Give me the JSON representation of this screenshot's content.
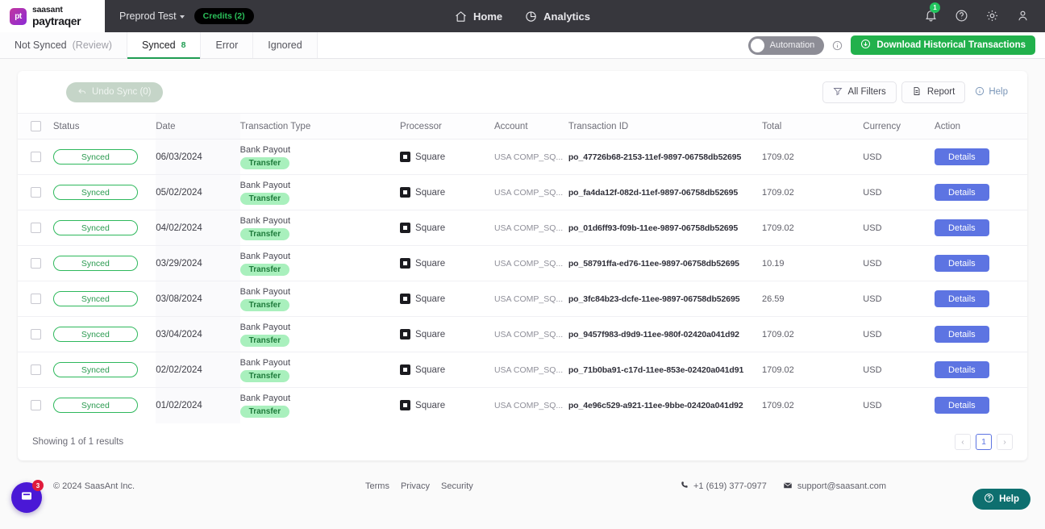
{
  "topbar": {
    "brand": {
      "mark": "pt",
      "line1": "saasant",
      "line2": "paytraqer"
    },
    "environment": "Preprod Test",
    "credits": "Credits (2)",
    "nav": [
      {
        "label": "Home",
        "icon": "home-icon"
      },
      {
        "label": "Analytics",
        "icon": "pie-chart-icon"
      }
    ],
    "notifications_count": "1",
    "icons": [
      "bell-icon",
      "help-circle-icon",
      "gear-icon",
      "user-icon"
    ]
  },
  "tabs": [
    {
      "label": "Not Synced",
      "sublabel": "(Review)",
      "count": "",
      "active": false
    },
    {
      "label": "Synced",
      "sublabel": "",
      "count": "8",
      "active": true
    },
    {
      "label": "Error",
      "sublabel": "",
      "count": "",
      "active": false
    },
    {
      "label": "Ignored",
      "sublabel": "",
      "count": "",
      "active": false
    }
  ],
  "toolbar": {
    "automation_label": "Automation",
    "download_label": "Download Historical Transactions",
    "undo_label": "Undo Sync (0)",
    "all_filters_label": "All Filters",
    "report_label": "Report",
    "help_label": "Help"
  },
  "table": {
    "columns": [
      "Status",
      "Date",
      "Transaction Type",
      "Processor",
      "Account",
      "Transaction ID",
      "Total",
      "Currency",
      "Action"
    ],
    "rows": [
      {
        "status": "Synced",
        "date": "06/03/2024",
        "type": "Bank Payout",
        "tag": "Transfer",
        "processor": "Square",
        "account": "USA COMP_SQ...",
        "txid": "po_47726b68-2153-11ef-9897-06758db52695",
        "total": "1709.02",
        "currency": "USD",
        "action": "Details"
      },
      {
        "status": "Synced",
        "date": "05/02/2024",
        "type": "Bank Payout",
        "tag": "Transfer",
        "processor": "Square",
        "account": "USA COMP_SQ...",
        "txid": "po_fa4da12f-082d-11ef-9897-06758db52695",
        "total": "1709.02",
        "currency": "USD",
        "action": "Details"
      },
      {
        "status": "Synced",
        "date": "04/02/2024",
        "type": "Bank Payout",
        "tag": "Transfer",
        "processor": "Square",
        "account": "USA COMP_SQ...",
        "txid": "po_01d6ff93-f09b-11ee-9897-06758db52695",
        "total": "1709.02",
        "currency": "USD",
        "action": "Details"
      },
      {
        "status": "Synced",
        "date": "03/29/2024",
        "type": "Bank Payout",
        "tag": "Transfer",
        "processor": "Square",
        "account": "USA COMP_SQ...",
        "txid": "po_58791ffa-ed76-11ee-9897-06758db52695",
        "total": "10.19",
        "currency": "USD",
        "action": "Details"
      },
      {
        "status": "Synced",
        "date": "03/08/2024",
        "type": "Bank Payout",
        "tag": "Transfer",
        "processor": "Square",
        "account": "USA COMP_SQ...",
        "txid": "po_3fc84b23-dcfe-11ee-9897-06758db52695",
        "total": "26.59",
        "currency": "USD",
        "action": "Details"
      },
      {
        "status": "Synced",
        "date": "03/04/2024",
        "type": "Bank Payout",
        "tag": "Transfer",
        "processor": "Square",
        "account": "USA COMP_SQ...",
        "txid": "po_9457f983-d9d9-11ee-980f-02420a041d92",
        "total": "1709.02",
        "currency": "USD",
        "action": "Details"
      },
      {
        "status": "Synced",
        "date": "02/02/2024",
        "type": "Bank Payout",
        "tag": "Transfer",
        "processor": "Square",
        "account": "USA COMP_SQ...",
        "txid": "po_71b0ba91-c17d-11ee-853e-02420a041d91",
        "total": "1709.02",
        "currency": "USD",
        "action": "Details"
      },
      {
        "status": "Synced",
        "date": "01/02/2024",
        "type": "Bank Payout",
        "tag": "Transfer",
        "processor": "Square",
        "account": "USA COMP_SQ...",
        "txid": "po_4e96c529-a921-11ee-9bbe-02420a041d92",
        "total": "1709.02",
        "currency": "USD",
        "action": "Details"
      }
    ]
  },
  "card_footer": {
    "showing": "Showing 1 of 1 results",
    "prev": "‹",
    "page": "1",
    "next": "›"
  },
  "page_footer": {
    "copyright": "© 2024 SaasAnt Inc.",
    "legal": [
      "Terms",
      "Privacy",
      "Security"
    ],
    "phone": "+1 (619) 377-0977",
    "email": "support@saasant.com",
    "help_fab": "Help",
    "chat_badge": "3"
  },
  "colors": {
    "accent_green": "#22b14c",
    "details_blue": "#5d74e2",
    "topbar_dark": "#37373d",
    "annotation_red": "#c4192f",
    "chat_purple": "#4a18d6",
    "help_teal": "#0e6f6f"
  }
}
